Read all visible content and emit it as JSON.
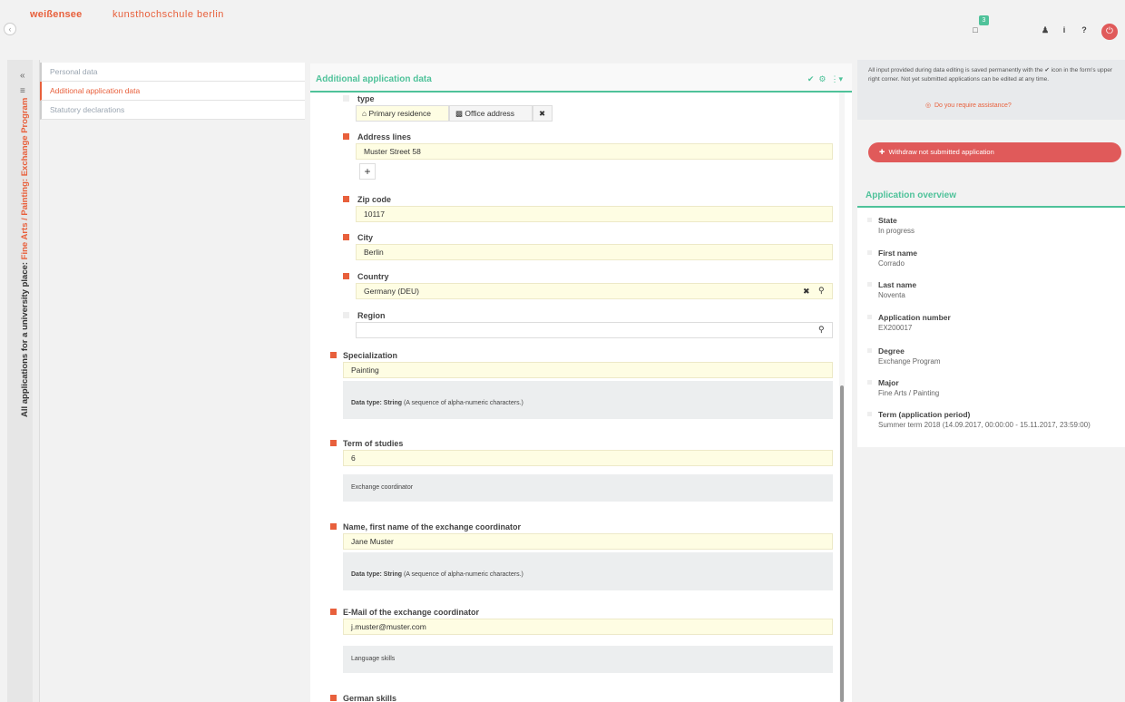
{
  "header": {
    "logo_left": "weißensee",
    "logo_right": "kunsthochschule berlin",
    "notif_count": "3"
  },
  "strip": {
    "prefix": "All applications for a university place: ",
    "highlight": "Fine Arts / Painting: Exchange Program"
  },
  "nav": {
    "items": [
      {
        "label": "Personal data"
      },
      {
        "label": "Additional application data"
      },
      {
        "label": "Statutory declarations"
      }
    ]
  },
  "main": {
    "title": "Additional application data",
    "type_label": "type",
    "type_options": [
      "Primary residence",
      "Office address"
    ],
    "address_label": "Address lines",
    "address_value": "Muster Street 58",
    "zip_label": "Zip code",
    "zip_value": "10117",
    "city_label": "City",
    "city_value": "Berlin",
    "country_label": "Country",
    "country_value": "Germany (DEU)",
    "region_label": "Region",
    "region_value": "",
    "spec_label": "Specialization",
    "spec_value": "Painting",
    "spec_hint_bold": "Data type: String",
    "spec_hint": " (A sequence of alpha-numeric characters.)",
    "term_label": "Term of studies",
    "term_value": "6",
    "exch_section": "Exchange coordinator",
    "coord_label": "Name, first name of the exchange coordinator",
    "coord_value": "Jane Muster",
    "coord_hint_bold": "Data type: String",
    "coord_hint": " (A sequence of alpha-numeric characters.)",
    "email_label": "E-Mail of the exchange coordinator",
    "email_value": "j.muster@muster.com",
    "lang_section": "Language skills",
    "german_label": "German skills"
  },
  "right": {
    "info": "All input provided during data editing is saved permanently with the ✔ icon in the form's upper right corner. Not yet submitted applications can be edited at any time.",
    "assist": "Do you require assistance?",
    "withdraw": "Withdraw not submitted application",
    "overview_title": "Application overview",
    "overview": [
      {
        "label": "State",
        "value": "In progress"
      },
      {
        "label": "First name",
        "value": "Corrado"
      },
      {
        "label": "Last name",
        "value": "Noventa"
      },
      {
        "label": "Application number",
        "value": "EX200017"
      },
      {
        "label": "Degree",
        "value": "Exchange Program"
      },
      {
        "label": "Major",
        "value": "Fine Arts / Painting"
      },
      {
        "label": "Term (application period)",
        "value": "Summer term 2018 (14.09.2017, 00:00:00 - 15.11.2017, 23:59:00)"
      }
    ]
  }
}
